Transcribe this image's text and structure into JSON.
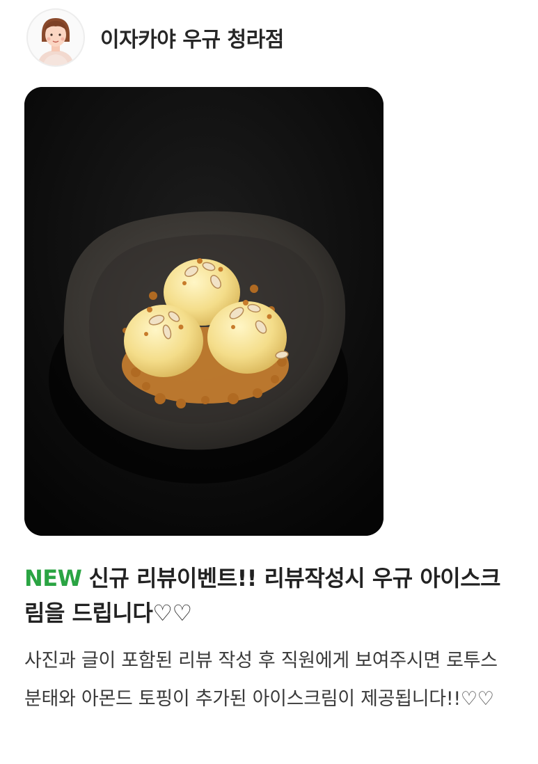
{
  "store": {
    "name": "이자카야 우규 청라점",
    "avatar_icon": "person-avatar-icon"
  },
  "photo": {
    "subject": "ice-cream-dessert-photo"
  },
  "event": {
    "badge": "NEW",
    "title": "신규 리뷰이벤트!! 리뷰작성시 우규 아이스크림을 드립니다♡♡",
    "description": "사진과 글이 포함된 리뷰 작성 후 직원에게 보여주시면 로투스 분태와 아몬드 토핑이 추가된 아이스크림이 제공됩니다!!♡♡"
  },
  "colors": {
    "badge": "#2aa443",
    "text": "#222222",
    "description": "#3a3a3a"
  }
}
